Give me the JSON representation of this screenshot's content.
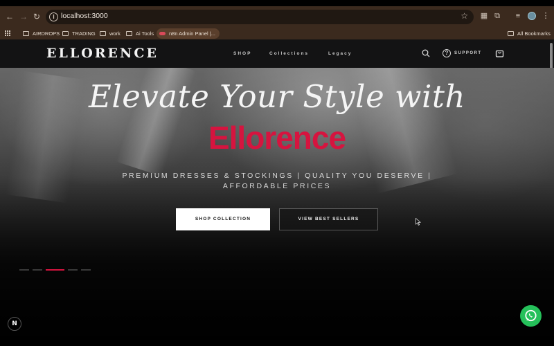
{
  "browser": {
    "url": "localhost:3000",
    "bookmarks": [
      {
        "label": "AIRDROPS"
      },
      {
        "label": "TRADING"
      },
      {
        "label": "work"
      },
      {
        "label": "Ai Tools"
      },
      {
        "label": "n8n Admin Panel |..."
      }
    ],
    "all_bookmarks": "All Bookmarks"
  },
  "site": {
    "logo": "ELLORENCE",
    "nav": [
      "SHOP",
      "Collections",
      "Legacy"
    ],
    "support_label": "SUPPORT"
  },
  "hero": {
    "headline": "Elevate Your Style with",
    "brand": "Ellorence",
    "tagline_line1": "PREMIUM DRESSES & STOCKINGS | QUALITY YOU DESERVE |",
    "tagline_line2": "AFFORDABLE PRICES",
    "primary_button": "SHOP COLLECTION",
    "secondary_button": "VIEW BEST SELLERS",
    "slide_count": 5,
    "active_slide": 3
  },
  "widgets": {
    "next_badge": "N"
  },
  "colors": {
    "accent": "#d6143f",
    "chrome": "#3b2a1e",
    "header": "#131314",
    "whatsapp": "#25c05a"
  }
}
